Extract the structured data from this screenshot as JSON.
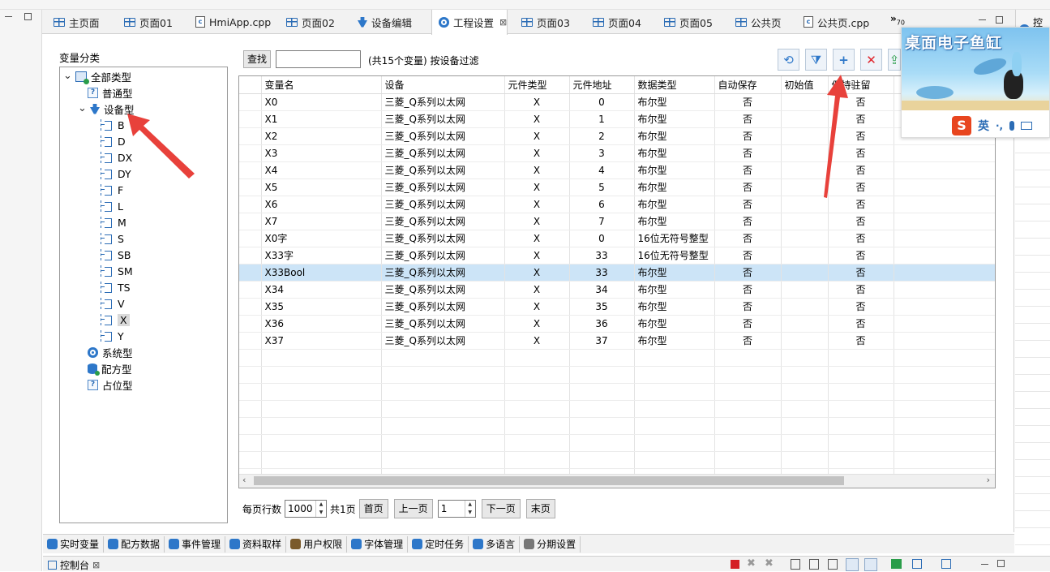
{
  "tabs": [
    {
      "label": "主页面",
      "icon": "page-icon"
    },
    {
      "label": "页面01",
      "icon": "page-icon"
    },
    {
      "label": "HmiApp.cpp",
      "icon": "cpp-file-icon"
    },
    {
      "label": "页面02",
      "icon": "page-icon"
    },
    {
      "label": "设备编辑",
      "icon": "device-icon"
    },
    {
      "label": "工程设置",
      "icon": "gear-icon",
      "active": true,
      "close": "⊠"
    },
    {
      "label": "页面03",
      "icon": "page-icon"
    },
    {
      "label": "页面04",
      "icon": "page-icon"
    },
    {
      "label": "页面05",
      "icon": "page-icon"
    },
    {
      "label": "公共页",
      "icon": "page-icon"
    },
    {
      "label": "公共页.cpp",
      "icon": "cpp-file-icon"
    }
  ],
  "tab_overflow": "»",
  "tab_overflow_count": "70",
  "right_panel_title": "控件",
  "variable_category": {
    "title": "变量分类",
    "tree": [
      {
        "label": "全部类型",
        "level": 0,
        "expanded": true,
        "icon": "all-types-icon"
      },
      {
        "label": "普通型",
        "level": 1,
        "icon": "question-icon"
      },
      {
        "label": "设备型",
        "level": 1,
        "expanded": true,
        "icon": "device-icon"
      },
      {
        "label": "B",
        "level": 2,
        "icon": "register-icon"
      },
      {
        "label": "D",
        "level": 2,
        "icon": "register-icon"
      },
      {
        "label": "DX",
        "level": 2,
        "icon": "register-icon"
      },
      {
        "label": "DY",
        "level": 2,
        "icon": "register-icon"
      },
      {
        "label": "F",
        "level": 2,
        "icon": "register-icon"
      },
      {
        "label": "L",
        "level": 2,
        "icon": "register-icon"
      },
      {
        "label": "M",
        "level": 2,
        "icon": "register-icon"
      },
      {
        "label": "S",
        "level": 2,
        "icon": "register-icon"
      },
      {
        "label": "SB",
        "level": 2,
        "icon": "register-icon"
      },
      {
        "label": "SM",
        "level": 2,
        "icon": "register-icon"
      },
      {
        "label": "TS",
        "level": 2,
        "icon": "register-icon"
      },
      {
        "label": "V",
        "level": 2,
        "icon": "register-icon"
      },
      {
        "label": "X",
        "level": 2,
        "icon": "register-icon",
        "selected": true
      },
      {
        "label": "Y",
        "level": 2,
        "icon": "register-icon"
      },
      {
        "label": "系统型",
        "level": 1,
        "icon": "gear-icon"
      },
      {
        "label": "配方型",
        "level": 1,
        "icon": "database-icon"
      },
      {
        "label": "占位型",
        "level": 1,
        "icon": "question-icon"
      }
    ]
  },
  "search": {
    "button_label": "查找",
    "value": "",
    "filter_text": "(共15个变量) 按设备过滤"
  },
  "toolbar_icons": [
    "refresh-link-icon",
    "filter-add-icon",
    "add-variable-icon",
    "delete-icon",
    "export-icon"
  ],
  "table": {
    "columns": [
      "变量名",
      "设备",
      "元件类型",
      "元件地址",
      "数据类型",
      "自动保存",
      "初始值",
      "保持驻留"
    ],
    "rows": [
      [
        "X0",
        "三菱_Q系列以太网",
        "X",
        "0",
        "布尔型",
        "否",
        "",
        "否"
      ],
      [
        "X1",
        "三菱_Q系列以太网",
        "X",
        "1",
        "布尔型",
        "否",
        "",
        "否"
      ],
      [
        "X2",
        "三菱_Q系列以太网",
        "X",
        "2",
        "布尔型",
        "否",
        "",
        "否"
      ],
      [
        "X3",
        "三菱_Q系列以太网",
        "X",
        "3",
        "布尔型",
        "否",
        "",
        "否"
      ],
      [
        "X4",
        "三菱_Q系列以太网",
        "X",
        "4",
        "布尔型",
        "否",
        "",
        "否"
      ],
      [
        "X5",
        "三菱_Q系列以太网",
        "X",
        "5",
        "布尔型",
        "否",
        "",
        "否"
      ],
      [
        "X6",
        "三菱_Q系列以太网",
        "X",
        "6",
        "布尔型",
        "否",
        "",
        "否"
      ],
      [
        "X7",
        "三菱_Q系列以太网",
        "X",
        "7",
        "布尔型",
        "否",
        "",
        "否"
      ],
      [
        "X0字",
        "三菱_Q系列以太网",
        "X",
        "0",
        "16位无符号整型",
        "否",
        "",
        "否"
      ],
      [
        "X33字",
        "三菱_Q系列以太网",
        "X",
        "33",
        "16位无符号整型",
        "否",
        "",
        "否"
      ],
      [
        "X33Bool",
        "三菱_Q系列以太网",
        "X",
        "33",
        "布尔型",
        "否",
        "",
        "否"
      ],
      [
        "X34",
        "三菱_Q系列以太网",
        "X",
        "34",
        "布尔型",
        "否",
        "",
        "否"
      ],
      [
        "X35",
        "三菱_Q系列以太网",
        "X",
        "35",
        "布尔型",
        "否",
        "",
        "否"
      ],
      [
        "X36",
        "三菱_Q系列以太网",
        "X",
        "36",
        "布尔型",
        "否",
        "",
        "否"
      ],
      [
        "X37",
        "三菱_Q系列以太网",
        "X",
        "37",
        "布尔型",
        "否",
        "",
        "否"
      ]
    ],
    "selected_row": 10,
    "empty_rows": 8
  },
  "pager": {
    "rows_label": "每页行数",
    "rows_value": "1000",
    "total_pages": "共1页",
    "first": "首页",
    "prev": "上一页",
    "page_value": "1",
    "next": "下一页",
    "last": "末页"
  },
  "bottom_tabs": [
    "实时变量",
    "配方数据",
    "事件管理",
    "资料取样",
    "用户权限",
    "字体管理",
    "定时任务",
    "多语言",
    "分期设置"
  ],
  "console": {
    "label": "控制台",
    "close": "⊠"
  },
  "ime_popup": {
    "title": "桌面电子鱼缸",
    "logo": "S",
    "lang": "英",
    "punct": "·,"
  },
  "colors": {
    "accent": "#2d77c9",
    "selected_row": "#cce4f7",
    "arrow": "#e8413b"
  }
}
